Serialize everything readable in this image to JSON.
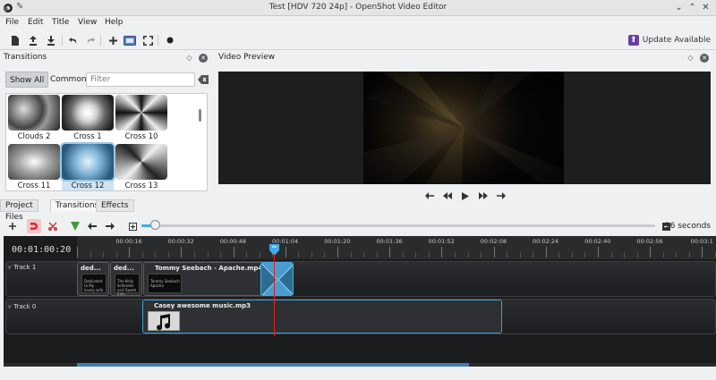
{
  "window": {
    "title": "Test [HDV 720 24p] - OpenShot Video Editor"
  },
  "menu": [
    "File",
    "Edit",
    "Title",
    "View",
    "Help"
  ],
  "toolbar": {
    "update_label": "Update Available"
  },
  "transitions_panel": {
    "title": "Transitions",
    "filter_show_all": "Show All",
    "filter_common": "Common",
    "filter_placeholder": "Filter",
    "items": [
      {
        "label": "Clouds 2"
      },
      {
        "label": "Cross 1"
      },
      {
        "label": "Cross 10"
      },
      {
        "label": "Cross 11"
      },
      {
        "label": "Cross 12",
        "selected": true
      },
      {
        "label": "Cross 13"
      }
    ],
    "tabs": [
      "Project Files",
      "Transitions",
      "Effects"
    ],
    "active_tab": "Transitions"
  },
  "video_preview": {
    "title": "Video Preview"
  },
  "timeline": {
    "zoom_label": "16 seconds",
    "zoom_fraction": 0.02,
    "current_time": "00:01:00:20",
    "ruler_labels": [
      "00:00:16",
      "00:00:32",
      "00:00:48",
      "00:01:04",
      "00:01:20",
      "00:01:36",
      "00:01:52",
      "00:02:08",
      "00:02:24",
      "00:02:40",
      "00:02:56",
      "00:03:1"
    ],
    "tracks": [
      {
        "name": "Track 1",
        "clips": [
          {
            "name": "ded...",
            "thumb_text": "Dedicated to\nMy lovely wife"
          },
          {
            "name": "ded...",
            "thumb_text": "The Kelly Schlieder\nand Sweet Kitty"
          },
          {
            "name": "Tommy Seebach - Apache.mp4",
            "thumb_text": "Tommy Seebach\nApache"
          }
        ]
      },
      {
        "name": "Track 0",
        "clips": [
          {
            "name": "Casey awesome music.mp3"
          }
        ]
      }
    ]
  },
  "colors": {
    "accent": "#3daee9",
    "update_badge": "#6b3fa0",
    "playhead": "#e02020",
    "timeline_bg": "#1b1c1e"
  }
}
